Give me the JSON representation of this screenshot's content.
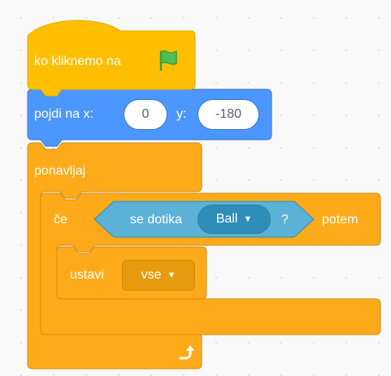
{
  "colors": {
    "events": "#ffbf00",
    "events_edge": "#e6ac00",
    "motion": "#4c97ff",
    "motion_edge": "#3373cc",
    "control": "#ffab19",
    "control_edge": "#cf8b17",
    "sensing": "#5cb1d6",
    "sensing_edge": "#2e8eb8",
    "flag_green": "#4cbf56"
  },
  "hat_block": {
    "label": "ko kliknemo na",
    "icon": "green-flag-icon"
  },
  "goto_block": {
    "label": "pojdi na x:",
    "x_value": "0",
    "y_label": "y:",
    "y_value": "-180"
  },
  "forever_block": {
    "label": "ponavljaj",
    "icon": "loop-arrow-icon"
  },
  "if_block": {
    "label": "če",
    "condition": {
      "label": "se dotika",
      "target": "Ball",
      "question_mark": "?"
    },
    "suffix": "potem"
  },
  "stop_block": {
    "label": "ustavi",
    "option": "vse"
  }
}
